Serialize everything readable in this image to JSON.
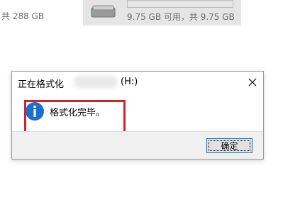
{
  "explorer": {
    "left_tile_text": "共 288 GB",
    "right_tile": {
      "icon": "drive-icon",
      "capacity_text": "9.75 GB 可用，共 9.75 GB",
      "usage_fraction": 0.0
    }
  },
  "dialog": {
    "title_prefix": "正在格式化",
    "title_drive": "(H:)",
    "close_label": "×",
    "message": "格式化完毕。",
    "icon": "info-icon",
    "ok_label": "确定",
    "highlight_color": "#d0232a"
  }
}
